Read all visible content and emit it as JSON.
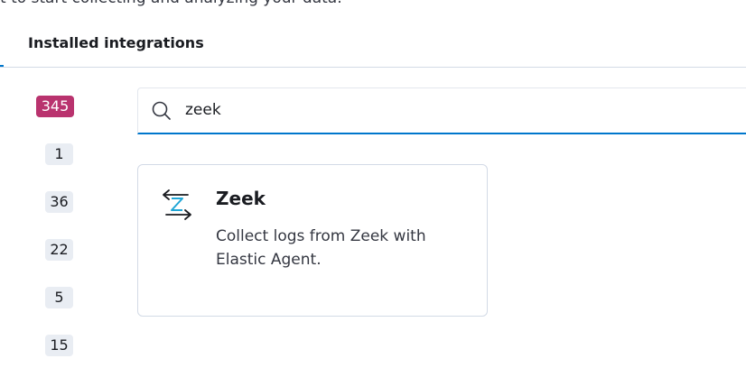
{
  "header": {
    "intro_text": "t to start collecting and analyzing your data."
  },
  "tabs": {
    "installed_label": "Installed integrations"
  },
  "sidebar": {
    "counts": [
      {
        "value": "345",
        "active": true
      },
      {
        "value": "1",
        "active": false
      },
      {
        "value": "36",
        "active": false
      },
      {
        "value": "22",
        "active": false
      },
      {
        "value": "5",
        "active": false
      },
      {
        "value": "15",
        "active": false
      }
    ]
  },
  "search": {
    "value": "zeek",
    "placeholder": ""
  },
  "results": [
    {
      "title": "Zeek",
      "description": "Collect logs from Zeek with Elastic Agent.",
      "icon": "zeek-logo-icon"
    }
  ],
  "colors": {
    "accent": "#0077cc",
    "active_badge": "#b9336e",
    "badge_bg": "#e9edf3"
  }
}
